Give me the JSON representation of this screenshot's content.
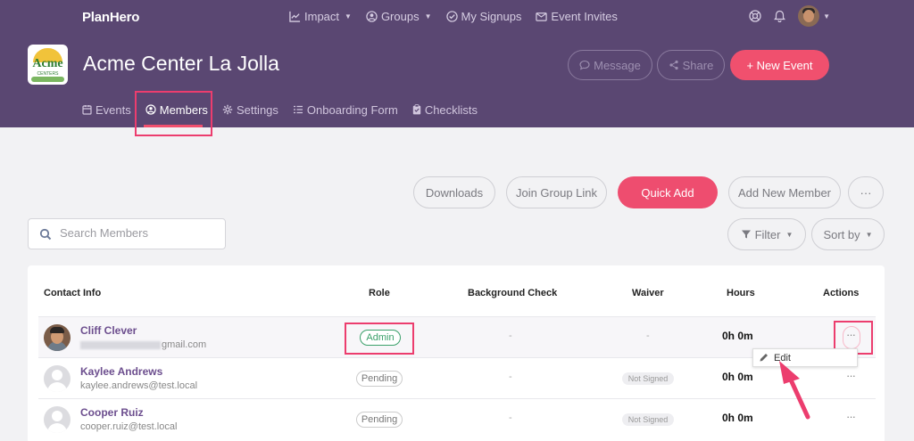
{
  "header": {
    "brand": "PlanHero",
    "nav": [
      {
        "label": "Impact",
        "icon": "chart-icon",
        "caret": true
      },
      {
        "label": "Groups",
        "icon": "user-circle-icon",
        "caret": true
      },
      {
        "label": "My Signups",
        "icon": "check-circle-icon",
        "caret": false
      },
      {
        "label": "Event Invites",
        "icon": "envelope-icon",
        "caret": false
      }
    ],
    "org_title": "Acme Center La Jolla",
    "logo_text": "Acme",
    "logo_sub": "CENTERS",
    "message_label": "Message",
    "share_label": "Share",
    "new_event_label": "+ New Event",
    "tabs": [
      {
        "label": "Events",
        "icon": "calendar-icon"
      },
      {
        "label": "Members",
        "icon": "user-circle-icon"
      },
      {
        "label": "Settings",
        "icon": "gear-icon"
      },
      {
        "label": "Onboarding Form",
        "icon": "list-icon"
      },
      {
        "label": "Checklists",
        "icon": "clipboard-icon"
      }
    ],
    "active_tab": "Members"
  },
  "toolbar": {
    "downloads_label": "Downloads",
    "join_label": "Join Group Link",
    "quick_add_label": "Quick Add",
    "add_member_label": "Add New Member",
    "more_label": "···",
    "filter_label": "Filter",
    "sort_label": "Sort by",
    "search_placeholder": "Search Members"
  },
  "table": {
    "headers": {
      "contact": "Contact Info",
      "role": "Role",
      "background": "Background Check",
      "waiver": "Waiver",
      "hours": "Hours",
      "actions": "Actions"
    },
    "rows": [
      {
        "name": "Cliff Clever",
        "email": "gmail.com",
        "role": "Admin",
        "background": "-",
        "waiver": "-",
        "hours": "0h 0m",
        "actions": "···"
      },
      {
        "name": "Kaylee Andrews",
        "email": "kaylee.andrews@test.local",
        "role": "Pending",
        "background": "-",
        "waiver": "Not Signed",
        "hours": "0h 0m",
        "actions": "···"
      },
      {
        "name": "Cooper Ruiz",
        "email": "cooper.ruiz@test.local",
        "role": "Pending",
        "background": "-",
        "waiver": "Not Signed",
        "hours": "0h 0m",
        "actions": "···"
      }
    ]
  },
  "dropdown": {
    "edit_label": "Edit"
  },
  "colors": {
    "header_bg": "#5a4772",
    "accent": "#f0506e",
    "highlight": "#ec3d6e",
    "admin_green": "#3aa06a",
    "name_purple": "#6c4e8e"
  }
}
